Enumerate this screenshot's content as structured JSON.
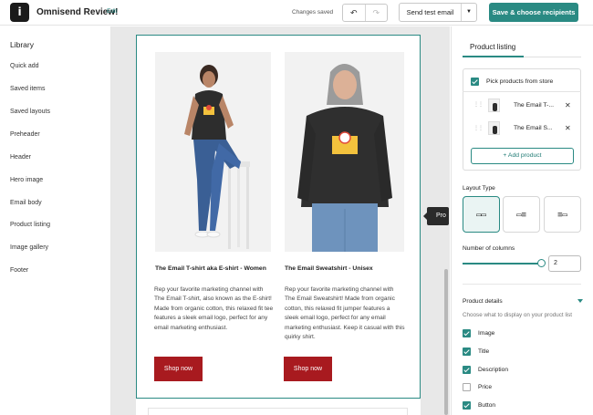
{
  "topbar": {
    "app_title": "Omnisend Review!",
    "edit_label": "Edit",
    "status": "Changes saved",
    "undo_icon": "undo-icon",
    "redo_icon": "redo-icon",
    "send_test_label": "Send test email",
    "save_label": "Save & choose recipients",
    "accent": "#2a8a83"
  },
  "library": {
    "title": "Library",
    "items": [
      "Quick add",
      "Saved items",
      "Saved layouts",
      "Preheader",
      "Header",
      "Hero image",
      "Email body",
      "Product listing",
      "Image gallery",
      "Footer"
    ]
  },
  "canvas": {
    "products": [
      {
        "title": "The Email T-shirt aka E-shirt - Women",
        "description": "Rep your favorite marketing channel with The Email T-shirt, also known as the E-shirt! Made from organic cotton, this relaxed fit tee features a sleek email logo, perfect for any email marketing enthusiast.",
        "button": "Shop now"
      },
      {
        "title": "The Email Sweatshirt - Unisex",
        "description": "Rep your favorite marketing channel with The Email Sweatshirt! Made from organic cotton, this relaxed fit jumper features a sleek email logo, perfect for any email marketing enthusiast. Keep it casual with this quirky shirt.",
        "button": "Shop now"
      }
    ],
    "button_color": "#a81a1f",
    "tooltip": "Pro"
  },
  "panel": {
    "tab": "Product listing",
    "pick_label": "Pick products from store",
    "picked": [
      "The Email T-...",
      "The Email S..."
    ],
    "add_product": "+ Add product",
    "layout_type_label": "Layout Type",
    "columns_label": "Number of columns",
    "columns_value": "2",
    "columns_slider": 1.0,
    "details_label": "Product details",
    "details_hint": "Choose what to display on your product list",
    "options": [
      {
        "label": "Image",
        "checked": true
      },
      {
        "label": "Title",
        "checked": true
      },
      {
        "label": "Description",
        "checked": true
      },
      {
        "label": "Price",
        "checked": false
      },
      {
        "label": "Button",
        "checked": true
      }
    ]
  }
}
